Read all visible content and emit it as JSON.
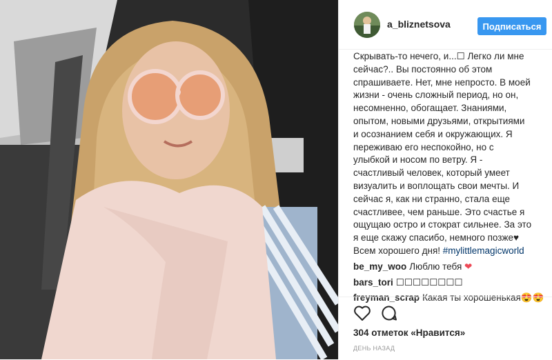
{
  "post": {
    "username": "a_bliznetsova",
    "follow_label": "Подписаться",
    "caption": "Скрывать-то нечего, и...☐ Легко ли мне\nсейчас?.. Вы постоянно об этом\nспрашиваете. Нет, мне непросто. В моей\nжизни - очень сложный период, но он,\nнесомненно, обогащает. Знаниями,\nопытом, новыми друзьями, открытиями\nи осознанием себя и окружающих. Я\nпереживаю его неспокойно, но с\nулыбкой и носом по ветру. Я -\nсчастливый человек, который умеет\nвизуалить и воплощать свои мечты. И\nсейчас я, как ни странно, стала еще\nсчастливее, чем раньше. Это счастье я\nощущаю остро и стократ сильнее. За это\nя еще скажу спасибо, немного позже♥\nВсем хорошего дня! ",
    "hashtag": "#mylittlemagicworld",
    "comments": [
      {
        "user": "be_my_woo",
        "text": "Люблю тебя",
        "emoji": "❤"
      },
      {
        "user": "bars_tori",
        "text": "☐☐☐☐☐☐☐☐",
        "emoji": ""
      },
      {
        "user": "freyman_scrap",
        "text": "Какая ты хорошенькая",
        "emoji": "😍😍"
      }
    ],
    "likes": "304 отметок «Нравится»",
    "time": "день назад"
  },
  "icons": {
    "like": "heart-outline-icon",
    "comment": "speech-bubble-icon"
  },
  "colors": {
    "follow_button": "#3897f0",
    "hashtag": "#003569",
    "heart": "#ed4956"
  }
}
